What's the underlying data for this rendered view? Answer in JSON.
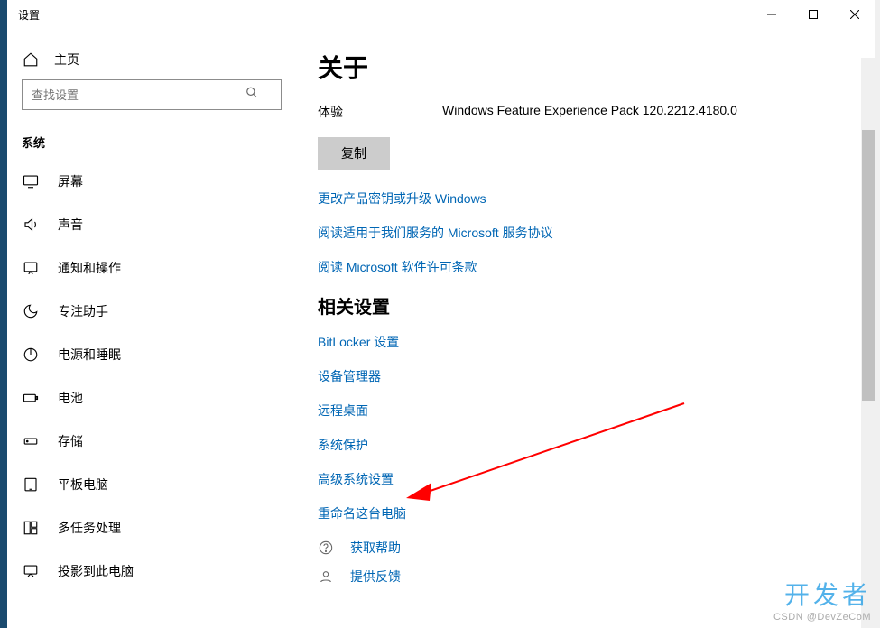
{
  "window": {
    "title": "设置",
    "minimize_label": "Minimize",
    "maximize_label": "Maximize",
    "close_label": "Close"
  },
  "sidebar": {
    "home_label": "主页",
    "search_placeholder": "查找设置",
    "section_label": "系统",
    "items": [
      {
        "id": "display",
        "label": "屏幕"
      },
      {
        "id": "sound",
        "label": "声音"
      },
      {
        "id": "notify",
        "label": "通知和操作"
      },
      {
        "id": "focus",
        "label": "专注助手"
      },
      {
        "id": "power",
        "label": "电源和睡眠"
      },
      {
        "id": "battery",
        "label": "电池"
      },
      {
        "id": "storage",
        "label": "存储"
      },
      {
        "id": "tablet",
        "label": "平板电脑"
      },
      {
        "id": "multitask",
        "label": "多任务处理"
      },
      {
        "id": "project",
        "label": "投影到此电脑"
      }
    ]
  },
  "content": {
    "title": "关于",
    "experience_label": "体验",
    "experience_value": "Windows Feature Experience Pack 120.2212.4180.0",
    "copy_button": "复制",
    "links_primary": [
      "更改产品密钥或升级 Windows",
      "阅读适用于我们服务的 Microsoft 服务协议",
      "阅读 Microsoft 软件许可条款"
    ],
    "related_heading": "相关设置",
    "links_related": [
      "BitLocker 设置",
      "设备管理器",
      "远程桌面",
      "系统保护",
      "高级系统设置",
      "重命名这台电脑"
    ],
    "help_link": "获取帮助",
    "feedback_link": "提供反馈"
  },
  "watermark": {
    "brand": "开发者",
    "sub": "CSDN @DevZeCoM"
  },
  "annotation": {
    "arrow_color": "#ff0000",
    "arrow_target": "高级系统设置"
  }
}
